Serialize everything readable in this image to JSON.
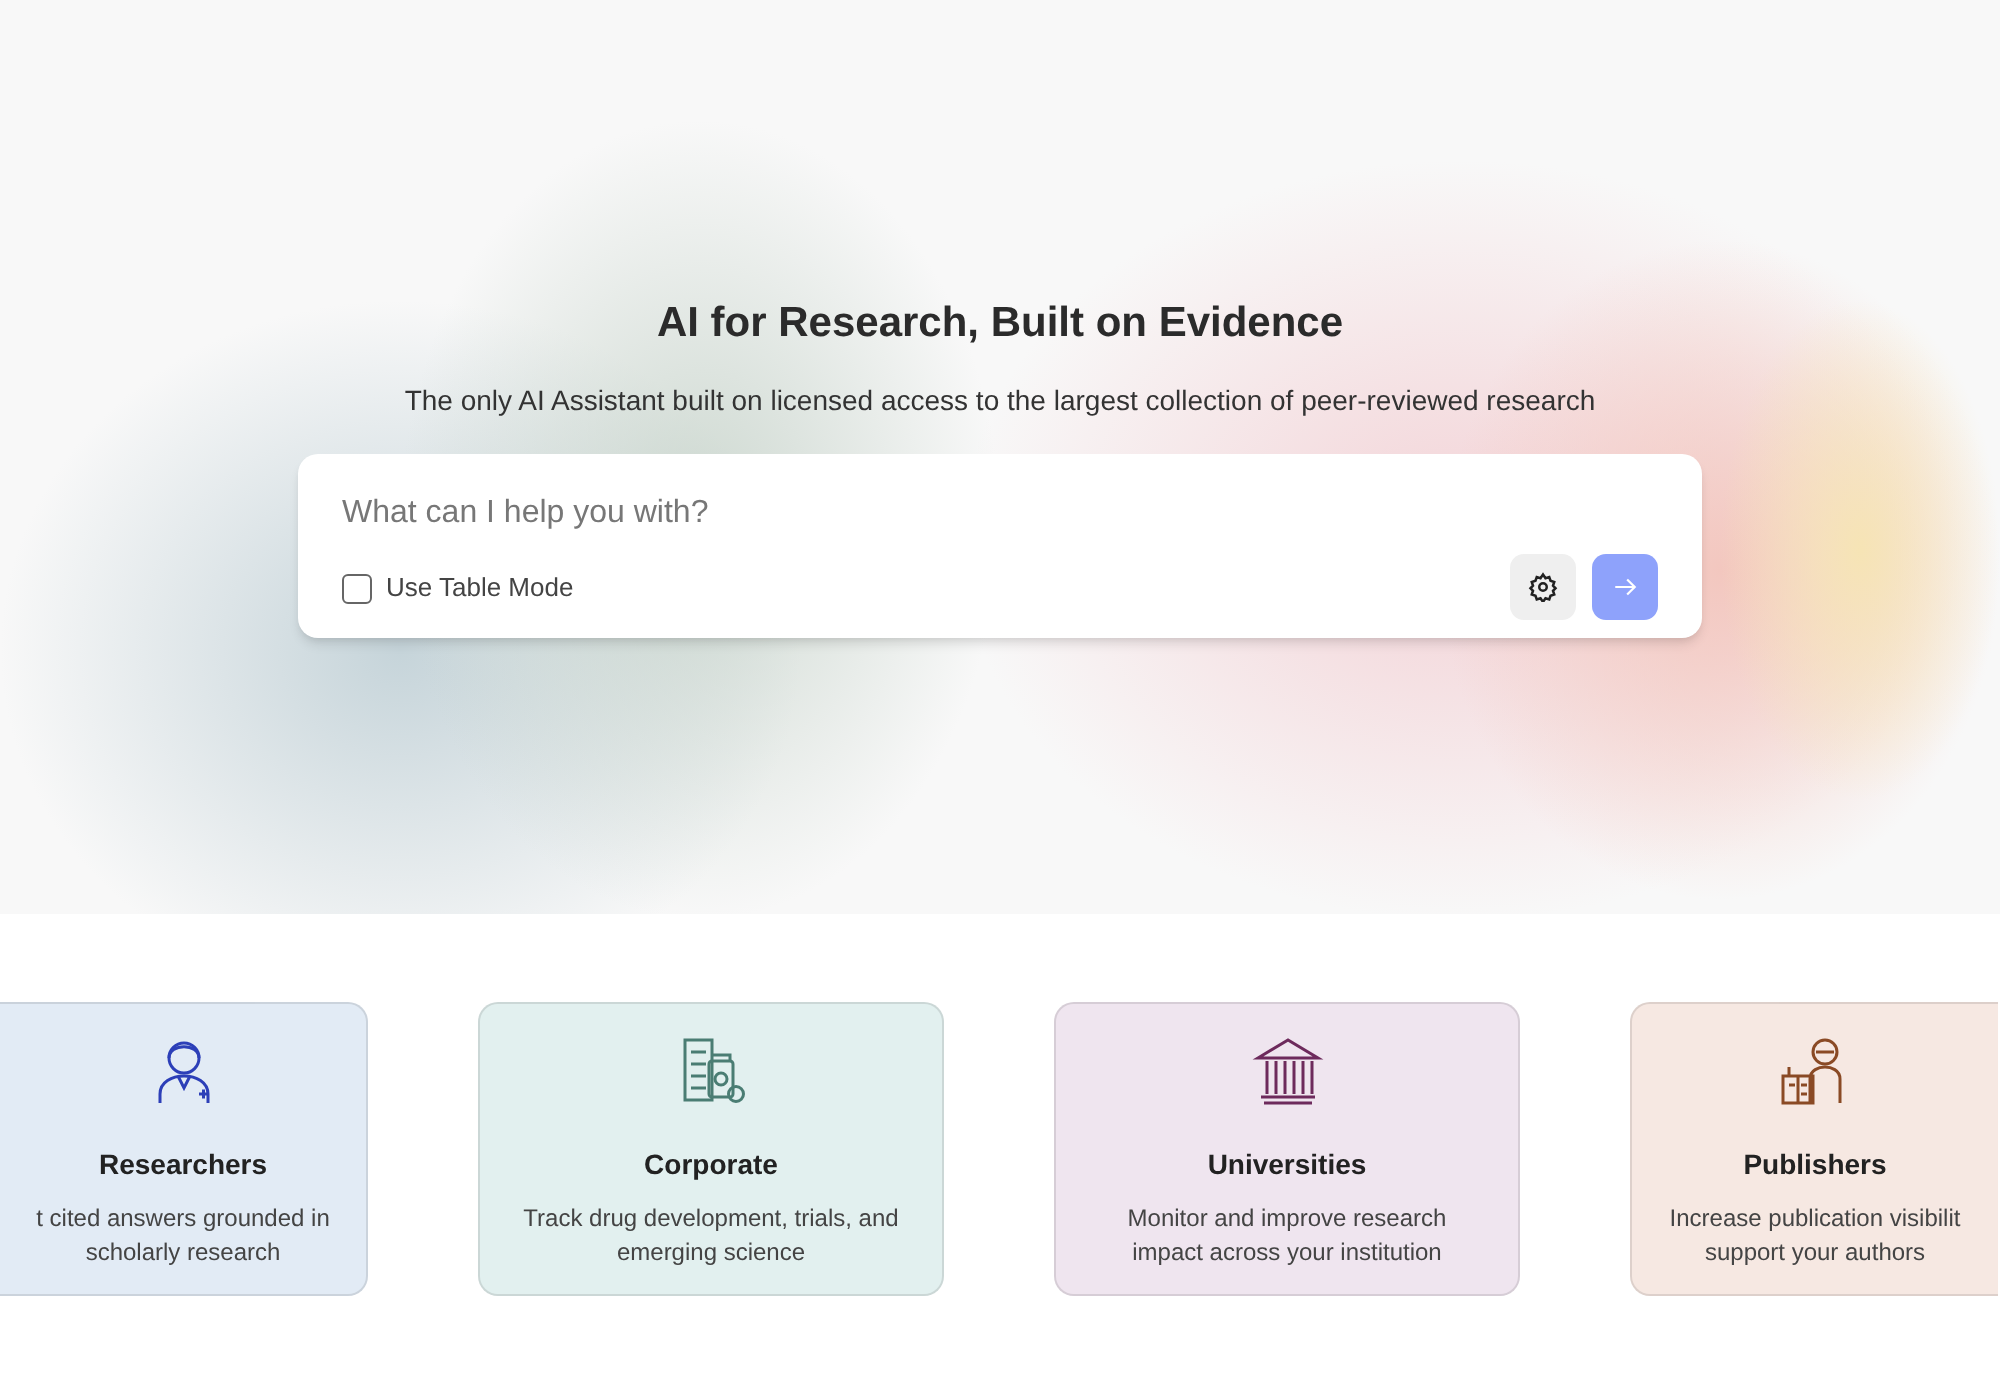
{
  "hero": {
    "title": "AI for Research, Built on Evidence",
    "subtitle": "The only AI Assistant built on licensed access to the largest collection of peer-reviewed research"
  },
  "search": {
    "placeholder": "What can I help you with?",
    "table_mode": {
      "label": "Use Table Mode",
      "checked": false
    }
  },
  "cards": [
    {
      "kind": "researcher",
      "title": "Researchers",
      "description": "t cited answers grounded in scholarly research",
      "color": "#e2ebf5"
    },
    {
      "kind": "corporate",
      "title": "Corporate",
      "description": "Track drug development, trials, and emerging science",
      "color": "#e2f0ef"
    },
    {
      "kind": "university",
      "title": "Universities",
      "description": "Monitor and improve research impact across your institution",
      "color": "#efe5ef"
    },
    {
      "kind": "publisher",
      "title": "Publishers",
      "description": "Increase publication visibilit support your authors",
      "color": "#f6e8e2"
    }
  ]
}
